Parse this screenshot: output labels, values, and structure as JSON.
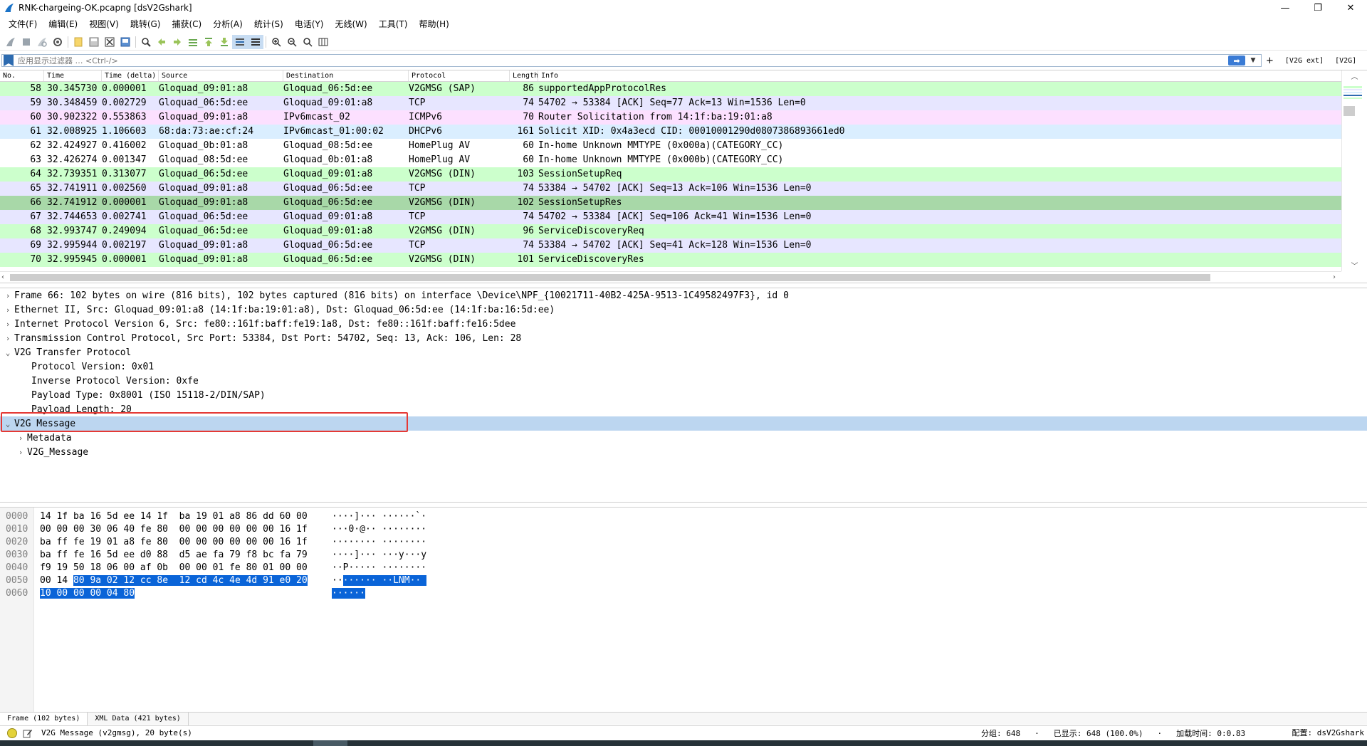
{
  "window": {
    "title": "RNK-chargeing-OK.pcapng [dsV2Gshark]",
    "controls": {
      "minimize": "—",
      "restore": "❐",
      "close": "✕"
    }
  },
  "menu": [
    "文件(F)",
    "编辑(E)",
    "视图(V)",
    "跳转(G)",
    "捕获(C)",
    "分析(A)",
    "统计(S)",
    "电话(Y)",
    "无线(W)",
    "工具(T)",
    "帮助(H)"
  ],
  "toolbar": {
    "icons": [
      "shark-fin-start-icon",
      "stop-icon",
      "restart-icon",
      "options-gear-icon",
      "open-file-icon",
      "save-file-icon",
      "close-file-icon",
      "reload-icon",
      "find-icon",
      "go-back-icon",
      "go-forward-icon",
      "go-to-packet-icon",
      "first-packet-icon",
      "last-packet-icon",
      "autoscroll-icon",
      "colorize-icon",
      "zoom-in-icon",
      "zoom-out-icon",
      "zoom-normal-icon",
      "resize-columns-icon"
    ]
  },
  "filter": {
    "placeholder": "应用显示过滤器 … <Ctrl-/>",
    "add_label": "+",
    "buttons": [
      "[V2G ext]",
      "[V2G]"
    ]
  },
  "packet_list": {
    "columns": [
      "No.",
      "Time",
      "Time (delta)",
      "Source",
      "Destination",
      "Protocol",
      "Length",
      "Info"
    ],
    "rows": [
      {
        "no": "58",
        "time": "30.345730",
        "delta": "0.000001",
        "src": "Gloquad_09:01:a8",
        "dst": "Gloquad_06:5d:ee",
        "proto": "V2GMSG (SAP)",
        "len": "86",
        "info": "supportedAppProtocolRes",
        "bg": "#ccffcc"
      },
      {
        "no": "59",
        "time": "30.348459",
        "delta": "0.002729",
        "src": "Gloquad_06:5d:ee",
        "dst": "Gloquad_09:01:a8",
        "proto": "TCP",
        "len": "74",
        "info": "54702 → 53384 [ACK] Seq=77 Ack=13 Win=1536 Len=0",
        "bg": "#e7e6ff"
      },
      {
        "no": "60",
        "time": "30.902322",
        "delta": "0.553863",
        "src": "Gloquad_09:01:a8",
        "dst": "IPv6mcast_02",
        "proto": "ICMPv6",
        "len": "70",
        "info": "Router Solicitation from 14:1f:ba:19:01:a8",
        "bg": "#fce0ff"
      },
      {
        "no": "61",
        "time": "32.008925",
        "delta": "1.106603",
        "src": "68:da:73:ae:cf:24",
        "dst": "IPv6mcast_01:00:02",
        "proto": "DHCPv6",
        "len": "161",
        "info": "Solicit XID: 0x4a3ecd CID: 00010001290d0807386893661ed0",
        "bg": "#daeeff"
      },
      {
        "no": "62",
        "time": "32.424927",
        "delta": "0.416002",
        "src": "Gloquad_0b:01:a8",
        "dst": "Gloquad_08:5d:ee",
        "proto": "HomePlug AV",
        "len": "60",
        "info": "In-home Unknown MMTYPE (0x000a)(CATEGORY_CC)",
        "bg": "#ffffff"
      },
      {
        "no": "63",
        "time": "32.426274",
        "delta": "0.001347",
        "src": "Gloquad_08:5d:ee",
        "dst": "Gloquad_0b:01:a8",
        "proto": "HomePlug AV",
        "len": "60",
        "info": "In-home Unknown MMTYPE (0x000b)(CATEGORY_CC)",
        "bg": "#ffffff"
      },
      {
        "no": "64",
        "time": "32.739351",
        "delta": "0.313077",
        "src": "Gloquad_06:5d:ee",
        "dst": "Gloquad_09:01:a8",
        "proto": "V2GMSG (DIN)",
        "len": "103",
        "info": "SessionSetupReq",
        "bg": "#ccffcc"
      },
      {
        "no": "65",
        "time": "32.741911",
        "delta": "0.002560",
        "src": "Gloquad_09:01:a8",
        "dst": "Gloquad_06:5d:ee",
        "proto": "TCP",
        "len": "74",
        "info": "53384 → 54702 [ACK] Seq=13 Ack=106 Win=1536 Len=0",
        "bg": "#e7e6ff"
      },
      {
        "no": "66",
        "time": "32.741912",
        "delta": "0.000001",
        "src": "Gloquad_09:01:a8",
        "dst": "Gloquad_06:5d:ee",
        "proto": "V2GMSG (DIN)",
        "len": "102",
        "info": "SessionSetupRes",
        "bg": "#a8d8a8"
      },
      {
        "no": "67",
        "time": "32.744653",
        "delta": "0.002741",
        "src": "Gloquad_06:5d:ee",
        "dst": "Gloquad_09:01:a8",
        "proto": "TCP",
        "len": "74",
        "info": "54702 → 53384 [ACK] Seq=106 Ack=41 Win=1536 Len=0",
        "bg": "#e7e6ff"
      },
      {
        "no": "68",
        "time": "32.993747",
        "delta": "0.249094",
        "src": "Gloquad_06:5d:ee",
        "dst": "Gloquad_09:01:a8",
        "proto": "V2GMSG (DIN)",
        "len": "96",
        "info": "ServiceDiscoveryReq",
        "bg": "#ccffcc"
      },
      {
        "no": "69",
        "time": "32.995944",
        "delta": "0.002197",
        "src": "Gloquad_09:01:a8",
        "dst": "Gloquad_06:5d:ee",
        "proto": "TCP",
        "len": "74",
        "info": "53384 → 54702 [ACK] Seq=41 Ack=128 Win=1536 Len=0",
        "bg": "#e7e6ff"
      },
      {
        "no": "70",
        "time": "32.995945",
        "delta": "0.000001",
        "src": "Gloquad_09:01:a8",
        "dst": "Gloquad_06:5d:ee",
        "proto": "V2GMSG (DIN)",
        "len": "101",
        "info": "ServiceDiscoveryRes",
        "bg": "#ccffcc"
      }
    ],
    "selected_no": "66"
  },
  "details": {
    "rows": [
      {
        "level": 1,
        "expander": "›",
        "text": "Frame 66: 102 bytes on wire (816 bits), 102 bytes captured (816 bits) on interface \\Device\\NPF_{10021711-40B2-425A-9513-1C49582497F3}, id 0"
      },
      {
        "level": 1,
        "expander": "›",
        "text": "Ethernet II, Src: Gloquad_09:01:a8 (14:1f:ba:19:01:a8), Dst: Gloquad_06:5d:ee (14:1f:ba:16:5d:ee)"
      },
      {
        "level": 1,
        "expander": "›",
        "text": "Internet Protocol Version 6, Src: fe80::161f:baff:fe19:1a8, Dst: fe80::161f:baff:fe16:5dee"
      },
      {
        "level": 1,
        "expander": "›",
        "text": "Transmission Control Protocol, Src Port: 53384, Dst Port: 54702, Seq: 13, Ack: 106, Len: 28"
      },
      {
        "level": 1,
        "expander": "⌄",
        "text": "V2G Transfer Protocol"
      },
      {
        "level": 2,
        "expander": "",
        "text": "Protocol Version: 0x01"
      },
      {
        "level": 2,
        "expander": "",
        "text": "Inverse Protocol Version: 0xfe"
      },
      {
        "level": 2,
        "expander": "",
        "text": "Payload Type: 0x8001 (ISO 15118-2/DIN/SAP)"
      },
      {
        "level": 2,
        "expander": "",
        "text": "Payload Length: 20"
      },
      {
        "level": 1,
        "expander": "⌄",
        "text": "V2G Message"
      },
      {
        "level": 2,
        "expander": "›",
        "text": "Metadata"
      },
      {
        "level": 2,
        "expander": "›",
        "text": "V2G_Message"
      }
    ],
    "selected_index": 9
  },
  "bytes": {
    "rows": [
      {
        "off": "0000",
        "hex_pre": "14 1f ba 16 5d ee 14 1f  ba 19 01 a8 86 dd 60 00",
        "hex_sel": "",
        "ascii_pre": "····]··· ······`·",
        "ascii_sel": ""
      },
      {
        "off": "0010",
        "hex_pre": "00 00 00 30 06 40 fe 80  00 00 00 00 00 00 16 1f",
        "hex_sel": "",
        "ascii_pre": "···0·@·· ········",
        "ascii_sel": ""
      },
      {
        "off": "0020",
        "hex_pre": "ba ff fe 19 01 a8 fe 80  00 00 00 00 00 00 16 1f",
        "hex_sel": "",
        "ascii_pre": "········ ········",
        "ascii_sel": ""
      },
      {
        "off": "0030",
        "hex_pre": "ba ff fe 16 5d ee d0 88  d5 ae fa 79 f8 bc fa 79",
        "hex_sel": "",
        "ascii_pre": "····]··· ···y···y",
        "ascii_sel": ""
      },
      {
        "off": "0040",
        "hex_pre": "f9 19 50 18 06 00 af 0b  00 00 01 fe 80 01 00 00",
        "hex_sel": "",
        "ascii_pre": "··P····· ········",
        "ascii_sel": ""
      },
      {
        "off": "0050",
        "hex_pre": "00 14 ",
        "hex_sel": "80 9a 02 12 cc 8e  12 cd 4c 4e 4d 91 e0 20",
        "ascii_pre": "··",
        "ascii_sel": "······ ··LNM·· "
      },
      {
        "off": "0060",
        "hex_pre": "",
        "hex_sel": "10 00 00 00 04 80",
        "ascii_pre": "",
        "ascii_sel": "······"
      }
    ],
    "tabs": [
      "Frame (102 bytes)",
      "XML Data (421 bytes)"
    ]
  },
  "status": {
    "message": "V2G Message (v2gmsg), 20 byte(s)",
    "packets": "分组: 648",
    "displayed": "已显示: 648 (100.0%)",
    "load_time": "加载时间: 0:0.83",
    "profile": "配置: dsV2Gshark"
  }
}
